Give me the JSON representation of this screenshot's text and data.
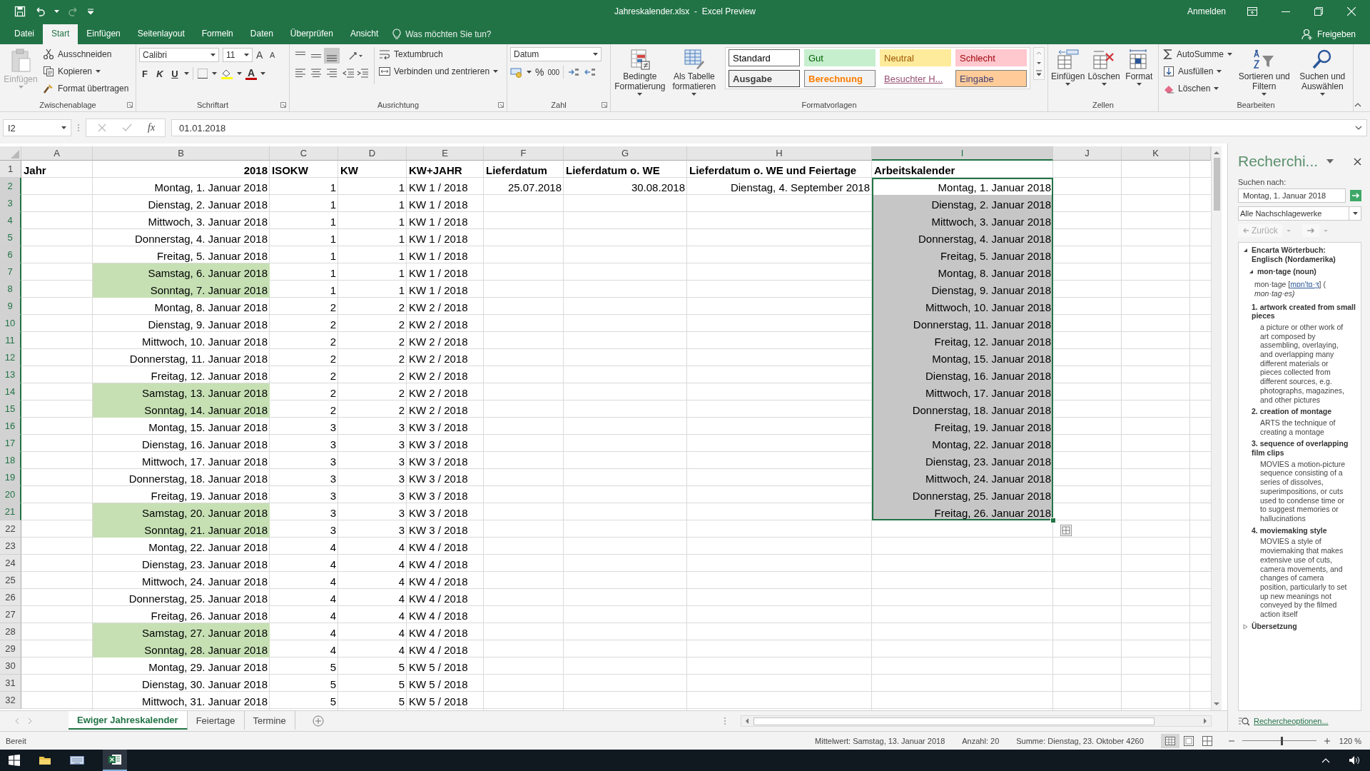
{
  "title_bar": {
    "title": "Jahreskalender.xlsx  -  Excel Preview",
    "account": "Anmelden"
  },
  "ribbon_tabs": [
    {
      "label": "Datei",
      "selected": false
    },
    {
      "label": "Start",
      "selected": true
    },
    {
      "label": "Einfügen",
      "selected": false
    },
    {
      "label": "Seitenlayout",
      "selected": false
    },
    {
      "label": "Formeln",
      "selected": false
    },
    {
      "label": "Daten",
      "selected": false
    },
    {
      "label": "Überprüfen",
      "selected": false
    },
    {
      "label": "Ansicht",
      "selected": false
    }
  ],
  "tell_me": "Was möchten Sie tun?",
  "share": "Freigeben",
  "ribbon_groups": [
    {
      "kind": "clipboard",
      "label": "Zwischenablage",
      "paste": {
        "label": "Einfügen",
        "disabled": true
      },
      "items": [
        "Ausschneiden",
        "Kopieren",
        "Format übertragen"
      ]
    },
    {
      "kind": "font",
      "label": "Schriftart",
      "font": "Calibri",
      "size": "11",
      "grow": "A",
      "shrink": "A",
      "styles": [
        "F",
        "K",
        "U"
      ],
      "color_letter": "A"
    },
    {
      "kind": "alignment",
      "label": "Ausrichtung",
      "items": [
        "Textumbruch",
        "Verbinden und zentrieren"
      ]
    },
    {
      "kind": "number",
      "label": "Zahl",
      "format": "Datum",
      "symbols": [
        "%",
        "000"
      ]
    },
    {
      "kind": "styles",
      "label": "Formatvorlagen",
      "buttons": [
        "Bedingte Formatierung",
        "Als Tabelle formatieren"
      ],
      "cell_styles": [
        {
          "label": "Standard",
          "color": "#ffffff"
        },
        {
          "label": "Gut",
          "color": "#c6efce"
        },
        {
          "label": "Neutral",
          "color": "#ffeb9c"
        },
        {
          "label": "Schlecht",
          "color": "#ffc7ce"
        },
        {
          "label": "Ausgabe",
          "color": "#f2f2f2"
        },
        {
          "label": "Berechnung",
          "color": "#f2f2f2"
        },
        {
          "label": "Besuchter H...",
          "color": "#ffffff"
        },
        {
          "label": "Eingabe",
          "color": "#ffcc99"
        }
      ]
    },
    {
      "kind": "cells",
      "label": "Zellen",
      "buttons": [
        "Einfügen",
        "Löschen",
        "Format"
      ]
    },
    {
      "kind": "editing",
      "label": "Bearbeiten",
      "items": [
        "AutoSumme",
        "Ausfüllen",
        "Löschen"
      ],
      "buttons": [
        "Sortieren und Filtern",
        "Suchen und Auswählen"
      ]
    }
  ],
  "formula_bar": {
    "name_box": "I2",
    "fx_label": "fx",
    "formula": "01.01.2018"
  },
  "sheet": {
    "columns": [
      {
        "label": "A",
        "selected": false
      },
      {
        "label": "B",
        "selected": false
      },
      {
        "label": "C",
        "selected": false
      },
      {
        "label": "D",
        "selected": false
      },
      {
        "label": "E",
        "selected": false
      },
      {
        "label": "F",
        "selected": false
      },
      {
        "label": "G",
        "selected": false
      },
      {
        "label": "H",
        "selected": false
      },
      {
        "label": "I",
        "selected": true
      },
      {
        "label": "J",
        "selected": false
      },
      {
        "label": "K",
        "selected": false
      }
    ],
    "rows": [
      {
        "number": "1",
        "kind": "header",
        "cells": {
          "A": "Jahr",
          "B": "2018",
          "C": "ISOKW",
          "D": "KW",
          "E": "KW+JAHR",
          "F": "Lieferdatum",
          "G": "Lieferdatum o. WE",
          "H": "Lieferdatum o. WE und Feiertage",
          "I": "Arbeitskalender"
        },
        "weekend": false,
        "selected": false
      },
      {
        "number": "2",
        "kind": "data",
        "cells": {
          "B": "Montag, 1. Januar 2018",
          "C": "1",
          "D": "1",
          "E": "KW 1 / 2018",
          "F": "25.07.2018",
          "G": "30.08.2018",
          "H": "Dienstag, 4. September 2018",
          "I": "Montag, 1. Januar 2018"
        },
        "weekend": false,
        "selected": true
      },
      {
        "number": "3",
        "kind": "data",
        "cells": {
          "B": "Dienstag, 2. Januar 2018",
          "C": "1",
          "D": "1",
          "E": "KW 1 / 2018",
          "I": "Dienstag, 2. Januar 2018"
        },
        "weekend": false,
        "selected": true
      },
      {
        "number": "4",
        "kind": "data",
        "cells": {
          "B": "Mittwoch, 3. Januar 2018",
          "C": "1",
          "D": "1",
          "E": "KW 1 / 2018",
          "I": "Mittwoch, 3. Januar 2018"
        },
        "weekend": false,
        "selected": true
      },
      {
        "number": "5",
        "kind": "data",
        "cells": {
          "B": "Donnerstag, 4. Januar 2018",
          "C": "1",
          "D": "1",
          "E": "KW 1 / 2018",
          "I": "Donnerstag, 4. Januar 2018"
        },
        "weekend": false,
        "selected": true
      },
      {
        "number": "6",
        "kind": "data",
        "cells": {
          "B": "Freitag, 5. Januar 2018",
          "C": "1",
          "D": "1",
          "E": "KW 1 / 2018",
          "I": "Freitag, 5. Januar 2018"
        },
        "weekend": false,
        "selected": true
      },
      {
        "number": "7",
        "kind": "data",
        "cells": {
          "B": "Samstag, 6. Januar 2018",
          "C": "1",
          "D": "1",
          "E": "KW 1 / 2018",
          "I": "Montag, 8. Januar 2018"
        },
        "weekend": true,
        "selected": true
      },
      {
        "number": "8",
        "kind": "data",
        "cells": {
          "B": "Sonntag, 7. Januar 2018",
          "C": "1",
          "D": "1",
          "E": "KW 1 / 2018",
          "I": "Dienstag, 9. Januar 2018"
        },
        "weekend": true,
        "selected": true
      },
      {
        "number": "9",
        "kind": "data",
        "cells": {
          "B": "Montag, 8. Januar 2018",
          "C": "2",
          "D": "2",
          "E": "KW 2 / 2018",
          "I": "Mittwoch, 10. Januar 2018"
        },
        "weekend": false,
        "selected": true
      },
      {
        "number": "10",
        "kind": "data",
        "cells": {
          "B": "Dienstag, 9. Januar 2018",
          "C": "2",
          "D": "2",
          "E": "KW 2 / 2018",
          "I": "Donnerstag, 11. Januar 2018"
        },
        "weekend": false,
        "selected": true
      },
      {
        "number": "11",
        "kind": "data",
        "cells": {
          "B": "Mittwoch, 10. Januar 2018",
          "C": "2",
          "D": "2",
          "E": "KW 2 / 2018",
          "I": "Freitag, 12. Januar 2018"
        },
        "weekend": false,
        "selected": true
      },
      {
        "number": "12",
        "kind": "data",
        "cells": {
          "B": "Donnerstag, 11. Januar 2018",
          "C": "2",
          "D": "2",
          "E": "KW 2 / 2018",
          "I": "Montag, 15. Januar 2018"
        },
        "weekend": false,
        "selected": true
      },
      {
        "number": "13",
        "kind": "data",
        "cells": {
          "B": "Freitag, 12. Januar 2018",
          "C": "2",
          "D": "2",
          "E": "KW 2 / 2018",
          "I": "Dienstag, 16. Januar 2018"
        },
        "weekend": false,
        "selected": true
      },
      {
        "number": "14",
        "kind": "data",
        "cells": {
          "B": "Samstag, 13. Januar 2018",
          "C": "2",
          "D": "2",
          "E": "KW 2 / 2018",
          "I": "Mittwoch, 17. Januar 2018"
        },
        "weekend": true,
        "selected": true
      },
      {
        "number": "15",
        "kind": "data",
        "cells": {
          "B": "Sonntag, 14. Januar 2018",
          "C": "2",
          "D": "2",
          "E": "KW 2 / 2018",
          "I": "Donnerstag, 18. Januar 2018"
        },
        "weekend": true,
        "selected": true
      },
      {
        "number": "16",
        "kind": "data",
        "cells": {
          "B": "Montag, 15. Januar 2018",
          "C": "3",
          "D": "3",
          "E": "KW 3 / 2018",
          "I": "Freitag, 19. Januar 2018"
        },
        "weekend": false,
        "selected": true
      },
      {
        "number": "17",
        "kind": "data",
        "cells": {
          "B": "Dienstag, 16. Januar 2018",
          "C": "3",
          "D": "3",
          "E": "KW 3 / 2018",
          "I": "Montag, 22. Januar 2018"
        },
        "weekend": false,
        "selected": true
      },
      {
        "number": "18",
        "kind": "data",
        "cells": {
          "B": "Mittwoch, 17. Januar 2018",
          "C": "3",
          "D": "3",
          "E": "KW 3 / 2018",
          "I": "Dienstag, 23. Januar 2018"
        },
        "weekend": false,
        "selected": true
      },
      {
        "number": "19",
        "kind": "data",
        "cells": {
          "B": "Donnerstag, 18. Januar 2018",
          "C": "3",
          "D": "3",
          "E": "KW 3 / 2018",
          "I": "Mittwoch, 24. Januar 2018"
        },
        "weekend": false,
        "selected": true
      },
      {
        "number": "20",
        "kind": "data",
        "cells": {
          "B": "Freitag, 19. Januar 2018",
          "C": "3",
          "D": "3",
          "E": "KW 3 / 2018",
          "I": "Donnerstag, 25. Januar 2018"
        },
        "weekend": false,
        "selected": true
      },
      {
        "number": "21",
        "kind": "data",
        "cells": {
          "B": "Samstag, 20. Januar 2018",
          "C": "3",
          "D": "3",
          "E": "KW 3 / 2018",
          "I": "Freitag, 26. Januar 2018"
        },
        "weekend": true,
        "selected": true
      },
      {
        "number": "22",
        "kind": "data",
        "cells": {
          "B": "Sonntag, 21. Januar 2018",
          "C": "3",
          "D": "3",
          "E": "KW 3 / 2018"
        },
        "weekend": true,
        "selected": false
      },
      {
        "number": "23",
        "kind": "data",
        "cells": {
          "B": "Montag, 22. Januar 2018",
          "C": "4",
          "D": "4",
          "E": "KW 4 / 2018"
        },
        "weekend": false,
        "selected": false
      },
      {
        "number": "24",
        "kind": "data",
        "cells": {
          "B": "Dienstag, 23. Januar 2018",
          "C": "4",
          "D": "4",
          "E": "KW 4 / 2018"
        },
        "weekend": false,
        "selected": false
      },
      {
        "number": "25",
        "kind": "data",
        "cells": {
          "B": "Mittwoch, 24. Januar 2018",
          "C": "4",
          "D": "4",
          "E": "KW 4 / 2018"
        },
        "weekend": false,
        "selected": false
      },
      {
        "number": "26",
        "kind": "data",
        "cells": {
          "B": "Donnerstag, 25. Januar 2018",
          "C": "4",
          "D": "4",
          "E": "KW 4 / 2018"
        },
        "weekend": false,
        "selected": false
      },
      {
        "number": "27",
        "kind": "data",
        "cells": {
          "B": "Freitag, 26. Januar 2018",
          "C": "4",
          "D": "4",
          "E": "KW 4 / 2018"
        },
        "weekend": false,
        "selected": false
      },
      {
        "number": "28",
        "kind": "data",
        "cells": {
          "B": "Samstag, 27. Januar 2018",
          "C": "4",
          "D": "4",
          "E": "KW 4 / 2018"
        },
        "weekend": true,
        "selected": false
      },
      {
        "number": "29",
        "kind": "data",
        "cells": {
          "B": "Sonntag, 28. Januar 2018",
          "C": "4",
          "D": "4",
          "E": "KW 4 / 2018"
        },
        "weekend": true,
        "selected": false
      },
      {
        "number": "30",
        "kind": "data",
        "cells": {
          "B": "Montag, 29. Januar 2018",
          "C": "5",
          "D": "5",
          "E": "KW 5 / 2018"
        },
        "weekend": false,
        "selected": false
      },
      {
        "number": "31",
        "kind": "data",
        "cells": {
          "B": "Dienstag, 30. Januar 2018",
          "C": "5",
          "D": "5",
          "E": "KW 5 / 2018"
        },
        "weekend": false,
        "selected": false
      },
      {
        "number": "32",
        "kind": "data",
        "cells": {
          "B": "Mittwoch, 31. Januar 2018",
          "C": "5",
          "D": "5",
          "E": "KW 5 / 2018"
        },
        "weekend": false,
        "selected": false
      }
    ]
  },
  "sheet_tabs": [
    {
      "label": "Ewiger Jahreskalender",
      "selected": true
    },
    {
      "label": "Feiertage",
      "selected": false
    },
    {
      "label": "Termine",
      "selected": false
    }
  ],
  "research_pane": {
    "title": "Recherchi...",
    "search_label": "Suchen nach:",
    "query": "Montag, 1. Januar 2018",
    "source": "Alle Nachschlagewerke",
    "back": "Zurück",
    "sections": [
      {
        "title": "Encarta Wörterbuch: Englisch (Nordamerika)",
        "expanded": true,
        "entry": {
          "headword": "mon·tage (noun)",
          "expanded": true,
          "pron_before": "mon·tage [",
          "pron_link": "mɒn'tɑ·ʒ",
          "pron_after": "] (",
          "plural": "mon·tag·es)",
          "senses": [
            {
              "title": "1. artwork created from small pieces",
              "text": "a picture or other work of art composed by assembling, overlaying, and overlapping many different materials or pieces collected from different sources, e.g. photographs, magazines, and other pictures"
            },
            {
              "title": "2. creation of montage",
              "text": "ARTS the technique of creating a montage"
            },
            {
              "title": "3. sequence of overlapping film clips",
              "text": "MOVIES a motion-picture sequence consisting of a series of dissolves, superimpositions, or cuts used to condense time or to suggest memories or hallucinations"
            },
            {
              "title": "4. moviemaking style",
              "text": "MOVIES a style of moviemaking that makes extensive use of cuts, camera movements, and changes of camera position, particularly to set up new meanings not conveyed by the filmed action itself"
            }
          ]
        }
      },
      {
        "title": "Übersetzung",
        "expanded": false
      }
    ],
    "options_link": "Rechercheoptionen..."
  },
  "status_bar": {
    "mode": "Bereit",
    "average": "Mittelwert: Samstag, 13. Januar 2018",
    "count": "Anzahl: 20",
    "sum": "Summe: Dienstag, 23. Oktober 4260",
    "zoom": "120 %",
    "level": 0.53
  }
}
